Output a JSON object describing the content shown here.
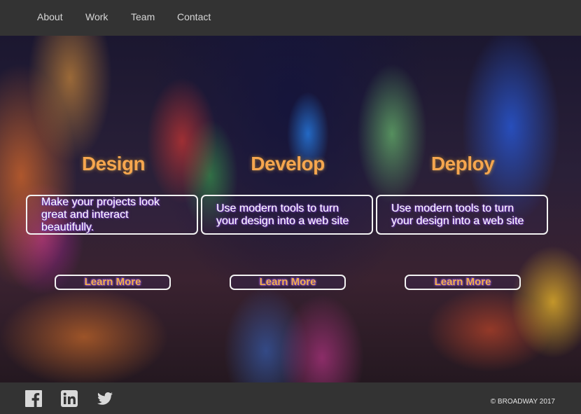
{
  "nav": {
    "items": [
      {
        "label": "About"
      },
      {
        "label": "Work"
      },
      {
        "label": "Team"
      },
      {
        "label": "Contact"
      }
    ]
  },
  "columns": [
    {
      "title": "Design",
      "text": "Make your projects look great and interact beautifully.",
      "button": "Learn More"
    },
    {
      "title": "Develop",
      "text": "Use modern tools to turn your design into a web site",
      "button": "Learn More"
    },
    {
      "title": "Deploy",
      "text": "Use modern tools to turn your design into a web site",
      "button": "Learn More"
    }
  ],
  "footer": {
    "social_icons": [
      "facebook-icon",
      "linkedin-icon",
      "twitter-icon"
    ],
    "copyright": "© BROADWAY 2017"
  },
  "colors": {
    "nav_bg": "#333333",
    "footer_bg": "#333333",
    "title_color": "#f6a64f",
    "button_text": "#f4b04a",
    "text_shadow": "#6a3aa8"
  }
}
